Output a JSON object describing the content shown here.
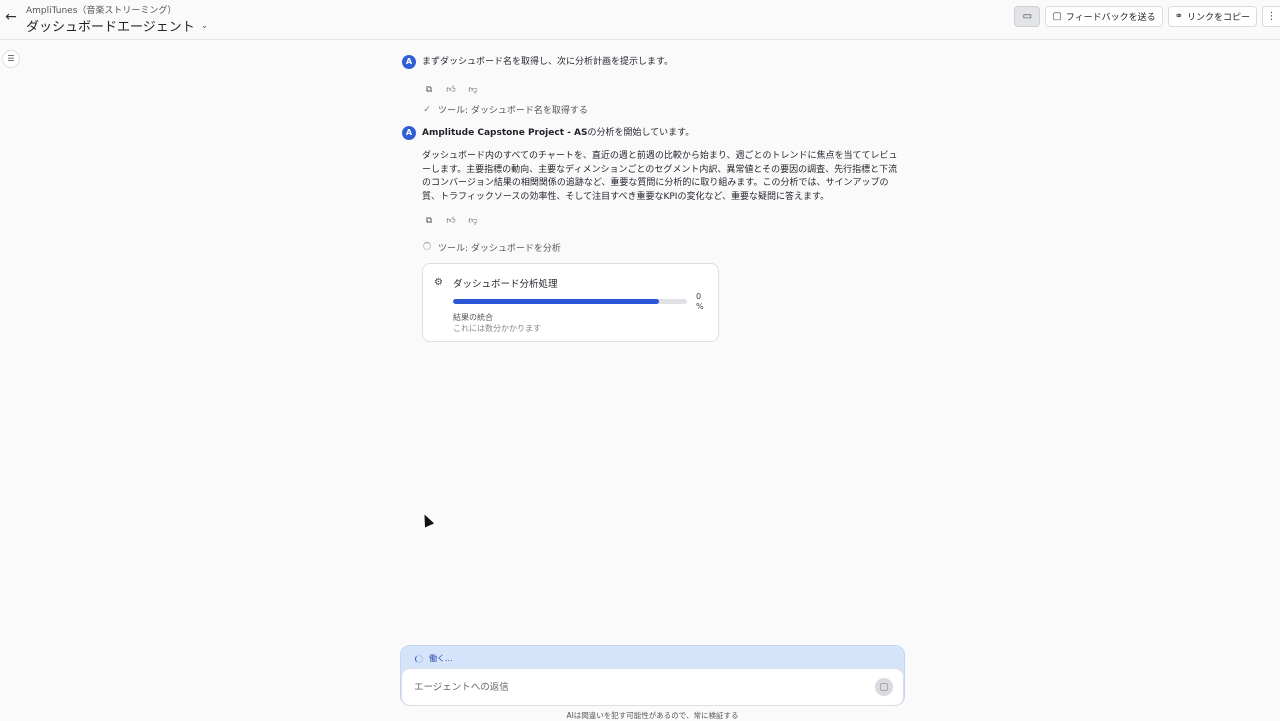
{
  "header": {
    "breadcrumb": "AmpliTunes（音楽ストリーミング）",
    "title": "ダッシュボードエージェント",
    "feedback_label": "フィードバックを送る",
    "copy_link_label": "リンクをコピー"
  },
  "messages": [
    {
      "text": "まずダッシュボード名を取得し、次に分析計画を提示します。"
    },
    {
      "bold": "Amplitude Capstone Project - AS",
      "text": "の分析を開始しています。",
      "body": "ダッシュボード内のすべてのチャートを、直近の週と前週の比較から始まり、週ごとのトレンドに焦点を当ててレビューします。主要指標の動向、主要なディメンションごとのセグメント内訳、異常値とその要因の調査、先行指標と下流のコンバージョン結果の相関関係の追跡など、重要な質問に分析的に取り組みます。この分析では、サインアップの質、トラフィックソースの効率性、そして注目すべき重要なKPIの変化など、重要な疑問に答えます。"
    }
  ],
  "tools": [
    {
      "label": "ツール: ダッシュボード名を取得する",
      "status": "done"
    },
    {
      "label": "ツール: ダッシュボードを分析",
      "status": "running"
    }
  ],
  "progress_card": {
    "title": "ダッシュボード分析処理",
    "percent_number": "0",
    "percent_symbol": "%",
    "fill_fraction": 0.88,
    "stage": "結果の統合",
    "stage_note": "これには数分かかります"
  },
  "composer": {
    "status": "働く...",
    "placeholder": "エージェントへの返信"
  },
  "disclaimer": "AIは間違いを犯す可能性があるので、常に検証する",
  "icons": {
    "back": "arrow-left-icon",
    "folder": "folder-icon",
    "feedback": "message-square-icon",
    "link": "link-icon",
    "more": "more-vertical-icon",
    "sidebar": "sidebar-toggle-icon",
    "avatar": "amplitude-logo-icon",
    "copy": "copy-icon",
    "thumbs_up": "thumbs-up-icon",
    "thumbs_down": "thumbs-down-icon",
    "check": "check-icon",
    "robot": "robot-icon"
  },
  "colors": {
    "accent": "#2b58d6",
    "composer_bg": "#d6e4fb"
  }
}
